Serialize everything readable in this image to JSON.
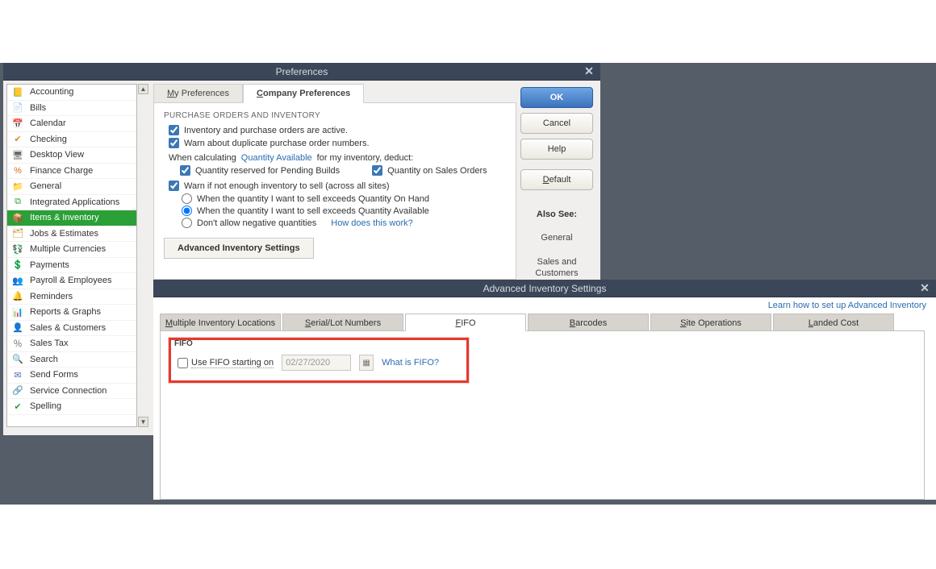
{
  "prefs": {
    "title": "Preferences",
    "sidebar": [
      {
        "label": "Accounting",
        "icon": "📒",
        "iconColor": "#c79a3a"
      },
      {
        "label": "Bills",
        "icon": "📄",
        "iconColor": "#4a74b5"
      },
      {
        "label": "Calendar",
        "icon": "📅",
        "iconColor": "#4a74b5"
      },
      {
        "label": "Checking",
        "icon": "✔",
        "iconColor": "#d68a2a"
      },
      {
        "label": "Desktop View",
        "icon": "🖥",
        "iconColor": "#6b6b6b"
      },
      {
        "label": "Finance Charge",
        "icon": "%",
        "iconColor": "#d26a1a"
      },
      {
        "label": "General",
        "icon": "📁",
        "iconColor": "#d6a32a"
      },
      {
        "label": "Integrated Applications",
        "icon": "⧉",
        "iconColor": "#2aa036"
      },
      {
        "label": "Items & Inventory",
        "icon": "📦",
        "iconColor": "#ffffff",
        "selected": true
      },
      {
        "label": "Jobs & Estimates",
        "icon": "🗂",
        "iconColor": "#b8881a"
      },
      {
        "label": "Multiple Currencies",
        "icon": "💱",
        "iconColor": "#2aa036"
      },
      {
        "label": "Payments",
        "icon": "💲",
        "iconColor": "#2aa036"
      },
      {
        "label": "Payroll & Employees",
        "icon": "👥",
        "iconColor": "#6b6b6b"
      },
      {
        "label": "Reminders",
        "icon": "🔔",
        "iconColor": "#d6a32a"
      },
      {
        "label": "Reports & Graphs",
        "icon": "📊",
        "iconColor": "#d26a1a"
      },
      {
        "label": "Sales & Customers",
        "icon": "👤",
        "iconColor": "#4a74b5"
      },
      {
        "label": "Sales Tax",
        "icon": "％",
        "iconColor": "#6b6b6b"
      },
      {
        "label": "Search",
        "icon": "🔍",
        "iconColor": "#6b6b6b"
      },
      {
        "label": "Send Forms",
        "icon": "✉",
        "iconColor": "#4a74b5"
      },
      {
        "label": "Service Connection",
        "icon": "🔗",
        "iconColor": "#6b6b6b"
      },
      {
        "label": "Spelling",
        "icon": "✔",
        "iconColor": "#2aa036"
      }
    ],
    "tabs": {
      "my": "My Preferences",
      "company": "Company Preferences"
    },
    "section": "PURCHASE ORDERS AND INVENTORY",
    "chk_active": "Inventory and purchase orders are active.",
    "chk_dup": "Warn about duplicate purchase order numbers.",
    "when_calc_pre": "When calculating",
    "qty_avail": "Quantity Available",
    "when_calc_post": "for my inventory, deduct:",
    "chk_pending": "Quantity reserved for Pending Builds",
    "chk_so": "Quantity on Sales Orders",
    "chk_warn": "Warn if not enough inventory to sell (across all sites)",
    "rad_onhand": "When the quantity I want to sell exceeds Quantity On Hand",
    "rad_avail": "When the quantity I want to sell exceeds Quantity Available",
    "rad_noneg": "Don't allow negative quantities",
    "how_link": "How does this work?",
    "adv_btn": "Advanced Inventory Settings",
    "buttons": {
      "ok": "OK",
      "cancel": "Cancel",
      "help": "Help",
      "default": "Default"
    },
    "also_see": "Also See:",
    "also1": "General",
    "also2": "Sales and Customers"
  },
  "adv": {
    "title": "Advanced Inventory Settings",
    "learn": "Learn how to set up Advanced Inventory",
    "tabs": [
      "Multiple Inventory Locations",
      "Serial/Lot Numbers",
      "FIFO",
      "Barcodes",
      "Site Operations",
      "Landed Cost"
    ],
    "fifo_legend": "FIFO",
    "fifo_chk": "Use FIFO starting on",
    "fifo_date": "02/27/2020",
    "fifo_link": "What is FIFO?"
  }
}
